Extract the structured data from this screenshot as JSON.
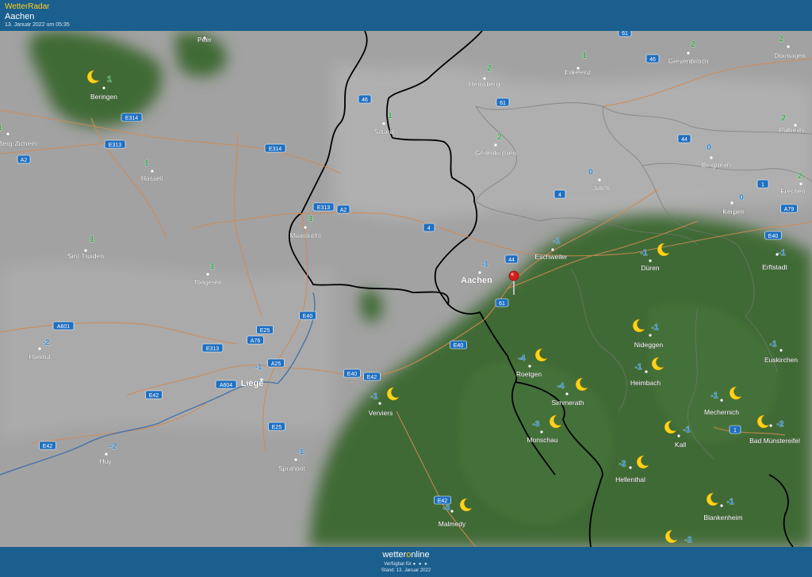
{
  "header": {
    "brand": "WetterRadar",
    "location": "Aachen",
    "timestamp": "13. Januar 2022 um 05:35"
  },
  "footer": {
    "logo_pre": "wetter",
    "logo_o": "o",
    "logo_post": "nline",
    "availability": "Verfügbar für",
    "availability_icons": "● ● ●",
    "stand": "Stand: 13. Januar 2022"
  },
  "colors": {
    "header": "#1a5f8e",
    "cloud": "#9c9c9c",
    "clear": "#3f6a36",
    "temp_positive": "#2fae46",
    "temp_negative": "#2b8bd6",
    "moon": "#ffd21a",
    "road_label": "#1f6fc0"
  },
  "icons": {
    "moon": "moon-icon",
    "pin": "location-pin-icon"
  },
  "cities": [
    {
      "name": "Peer",
      "temp": ""
    },
    {
      "name": "Beringen",
      "temp": "1",
      "moon": true
    },
    {
      "name": "Sittard",
      "temp": "1"
    },
    {
      "name": "Heinsberg",
      "temp": "2"
    },
    {
      "name": "Erkelenz",
      "temp": "1"
    },
    {
      "name": "Grevenbroich",
      "temp": "2"
    },
    {
      "name": "Dormagen",
      "temp": "2"
    },
    {
      "name": "Hasselt",
      "temp": "1"
    },
    {
      "name": "Geilenkirchen",
      "temp": "2"
    },
    {
      "name": "Bergheim",
      "temp": "0"
    },
    {
      "name": "Pulheim",
      "temp": "2"
    },
    {
      "name": "Jülich",
      "temp": "0"
    },
    {
      "name": "Frechen",
      "temp": "2"
    },
    {
      "name": "Kerpen",
      "temp": "0"
    },
    {
      "name": "Maastricht",
      "temp": "1"
    },
    {
      "name": "Sint-Truiden",
      "temp": "1"
    },
    {
      "name": "Tongeren",
      "temp": "1"
    },
    {
      "name": "Eschweiler",
      "temp": "-1"
    },
    {
      "name": "Düren",
      "temp": "-1",
      "moon": true
    },
    {
      "name": "Erftstadt",
      "temp": "-1"
    },
    {
      "name": "Aachen",
      "temp": "-1"
    },
    {
      "name": "Hannut",
      "temp": "-2"
    },
    {
      "name": "Nideggen",
      "temp": "-1",
      "moon": true
    },
    {
      "name": "Euskirchen",
      "temp": "-1"
    },
    {
      "name": "Roetgen",
      "temp": "-4",
      "moon": true
    },
    {
      "name": "Heimbach",
      "temp": "-1",
      "moon": true
    },
    {
      "name": "Liège",
      "temp": "-1"
    },
    {
      "name": "Verviers",
      "temp": "-1",
      "moon": true
    },
    {
      "name": "Simmerath",
      "temp": "-4",
      "moon": true
    },
    {
      "name": "Mechernich",
      "temp": "-1",
      "moon": true
    },
    {
      "name": "Monschau",
      "temp": "-3",
      "moon": true
    },
    {
      "name": "Kall",
      "temp": "-1",
      "moon": true
    },
    {
      "name": "Bad Münstereifel",
      "temp": "-2",
      "moon": true
    },
    {
      "name": "Huy",
      "temp": "-2"
    },
    {
      "name": "Sprimont",
      "temp": "-1"
    },
    {
      "name": "Hellenthal",
      "temp": "-2",
      "moon": true
    },
    {
      "name": "Malmedy",
      "temp": "-3",
      "moon": true
    },
    {
      "name": "Blankenheim",
      "temp": "-1",
      "moon": true
    },
    {
      "name": "",
      "temp": "-2",
      "moon": true
    },
    {
      "name": "Berg-Zichem",
      "temp": "1"
    }
  ],
  "roads": [
    "61",
    "46",
    "E314",
    "E313",
    "E314",
    "A2",
    "46",
    "61",
    "44",
    "4",
    "1",
    "A79",
    "A2",
    "E313",
    "A76",
    "4",
    "44",
    "61",
    "E40",
    "A601",
    "E25",
    "E40",
    "E313",
    "A25",
    "E40",
    "E42",
    "A604",
    "E42",
    "E25",
    "E42",
    "E42",
    "1",
    "E40"
  ]
}
